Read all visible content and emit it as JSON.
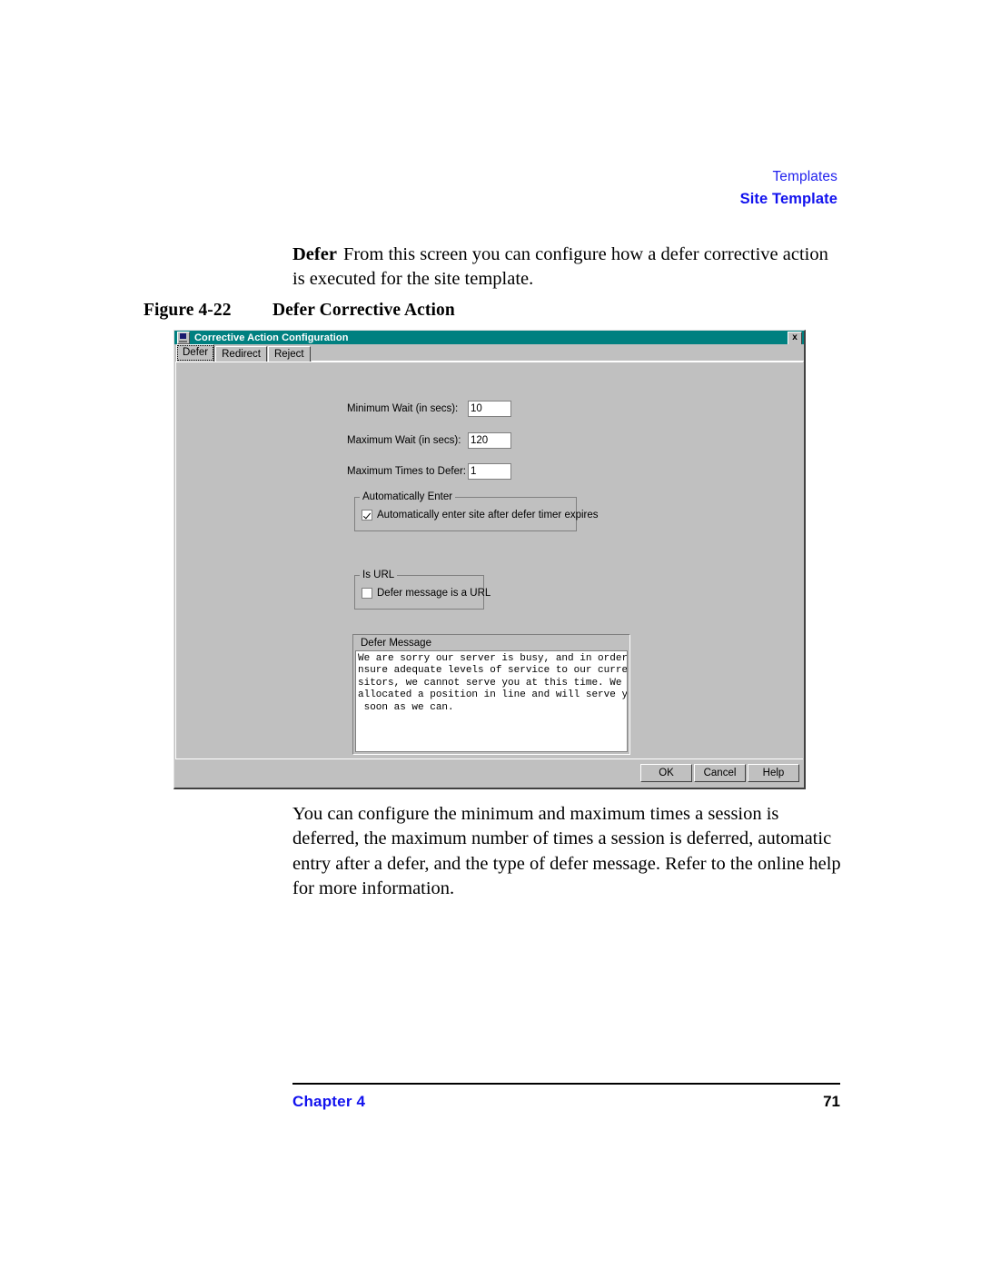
{
  "header": {
    "line1": "Templates",
    "line2": "Site Template"
  },
  "intro": {
    "lead": "Defer",
    "text": "From this screen you can configure how a defer corrective action is executed for the site template."
  },
  "figure": {
    "number": "Figure 4-22",
    "title": "Defer Corrective Action"
  },
  "outro": {
    "text": "You can configure the minimum and maximum times a session is deferred, the maximum number of times a session is deferred, automatic entry after a defer, and the type of defer message. Refer to the online help for more information."
  },
  "footer": {
    "chapter": "Chapter 4",
    "page": "71"
  },
  "dialog": {
    "title": "Corrective Action Configuration",
    "close_label": "x",
    "tabs": [
      {
        "label": "Defer",
        "active": true
      },
      {
        "label": "Redirect",
        "active": false
      },
      {
        "label": "Reject",
        "active": false
      }
    ],
    "fields": [
      {
        "label": "Minimum Wait (in secs):",
        "value": "10"
      },
      {
        "label": "Maximum Wait (in secs):",
        "value": "120"
      },
      {
        "label": "Maximum Times to Defer:",
        "value": "1"
      }
    ],
    "auto_enter": {
      "group_title": "Automatically Enter",
      "checkbox_label": "Automatically enter site after defer timer expires",
      "checked": true
    },
    "is_url": {
      "group_title": "Is URL",
      "checkbox_label": "Defer message is a URL",
      "checked": false
    },
    "defer_message": {
      "title": "Defer Message",
      "value": "We are sorry our server is busy, and in order to e\nnsure adequate levels of service to our current vi\nsitors, we cannot serve you at this time. We have\nallocated a position in line and will serve you as\n soon as we can."
    },
    "buttons": {
      "ok": "OK",
      "cancel": "Cancel",
      "help": "Help"
    },
    "colors": {
      "titlebar": "#008080",
      "face": "#c0c0c0",
      "field": "#ffffff"
    }
  }
}
